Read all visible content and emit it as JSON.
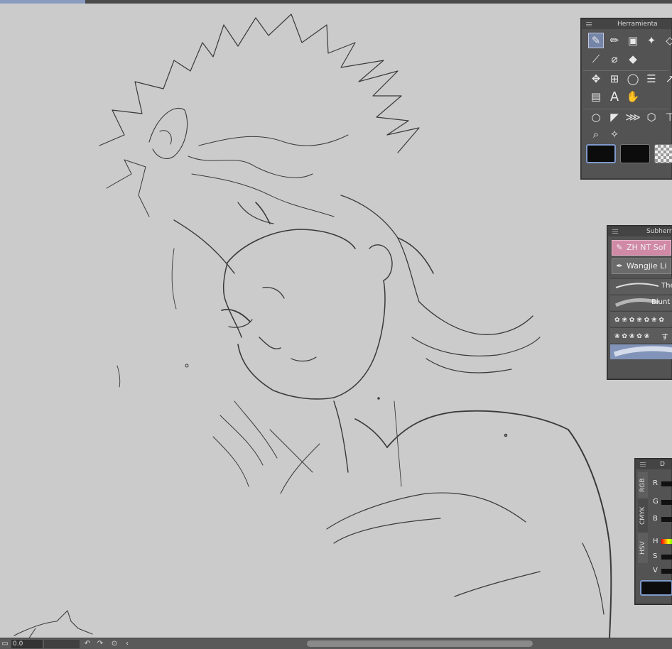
{
  "tool_panel": {
    "title": "Herramienta",
    "tools_row1": [
      "brush-icon",
      "pen-icon",
      "gradient-icon",
      "sparkle-icon",
      "eraser-icon"
    ],
    "tools_row2": [
      "eyedropper-icon",
      "pencil-icon",
      "fill-bucket-icon"
    ],
    "tools_row3": [
      "move-icon",
      "transform-icon",
      "lasso-icon",
      "selection-icon",
      "arrow-icon"
    ],
    "tools_row4": [
      "layer-icon",
      "text-icon",
      "hand-icon"
    ],
    "tools_row5": [
      "circle-icon",
      "ruler-icon",
      "perspective-icon",
      "3d-icon",
      "pin-icon"
    ],
    "tools_row6": [
      "zoom-icon",
      "sparkle-add-icon"
    ],
    "colors": [
      "#0c0c0c",
      "#0c0c0c",
      "transparent"
    ]
  },
  "subtool_panel": {
    "title": "Subherra",
    "btn_primary": "ZH NT Sof",
    "btn_secondary": "Wangjie Li",
    "brushes": [
      "The",
      "Blunt S",
      "",
      "す",
      ""
    ]
  },
  "color_panel": {
    "title": "D",
    "tabs": [
      "RGB",
      "CMYK",
      "HSV"
    ],
    "rgb": [
      "R",
      "G",
      "B"
    ],
    "hsv": [
      "H",
      "S",
      "V"
    ]
  },
  "statusbar": {
    "zoom_value": "0.0"
  }
}
